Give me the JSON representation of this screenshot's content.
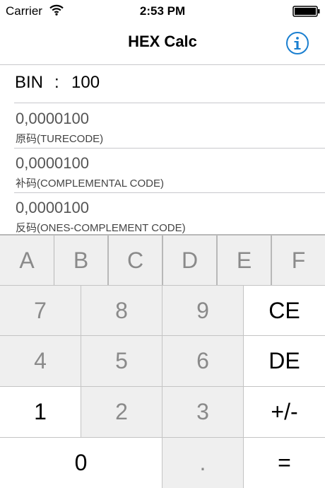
{
  "status": {
    "carrier": "Carrier",
    "time": "2:53 PM"
  },
  "nav": {
    "title": "HEX Calc"
  },
  "input": {
    "label": "BIN",
    "separator": ":",
    "value": "100"
  },
  "results": [
    {
      "value": "0,0000100",
      "label": "原码(TURECODE)"
    },
    {
      "value": "0,0000100",
      "label": "补码(COMPLEMENTAL CODE)"
    },
    {
      "value": "0,0000100",
      "label": "反码(ONES-COMPLEMENT CODE)"
    }
  ],
  "hex_keys": [
    "A",
    "B",
    "C",
    "D",
    "E",
    "F"
  ],
  "keys": {
    "k7": "7",
    "k8": "8",
    "k9": "9",
    "ce": "CE",
    "k4": "4",
    "k5": "5",
    "k6": "6",
    "de": "DE",
    "k1": "1",
    "k2": "2",
    "k3": "3",
    "sign": "+/-",
    "k0": "0",
    "dot": ".",
    "eq": "="
  },
  "colors": {
    "accent": "#1a7fd0",
    "key_disabled_bg": "#efefef",
    "key_enabled_bg": "#ffffff",
    "key_disabled_text": "#8a8a8a"
  }
}
